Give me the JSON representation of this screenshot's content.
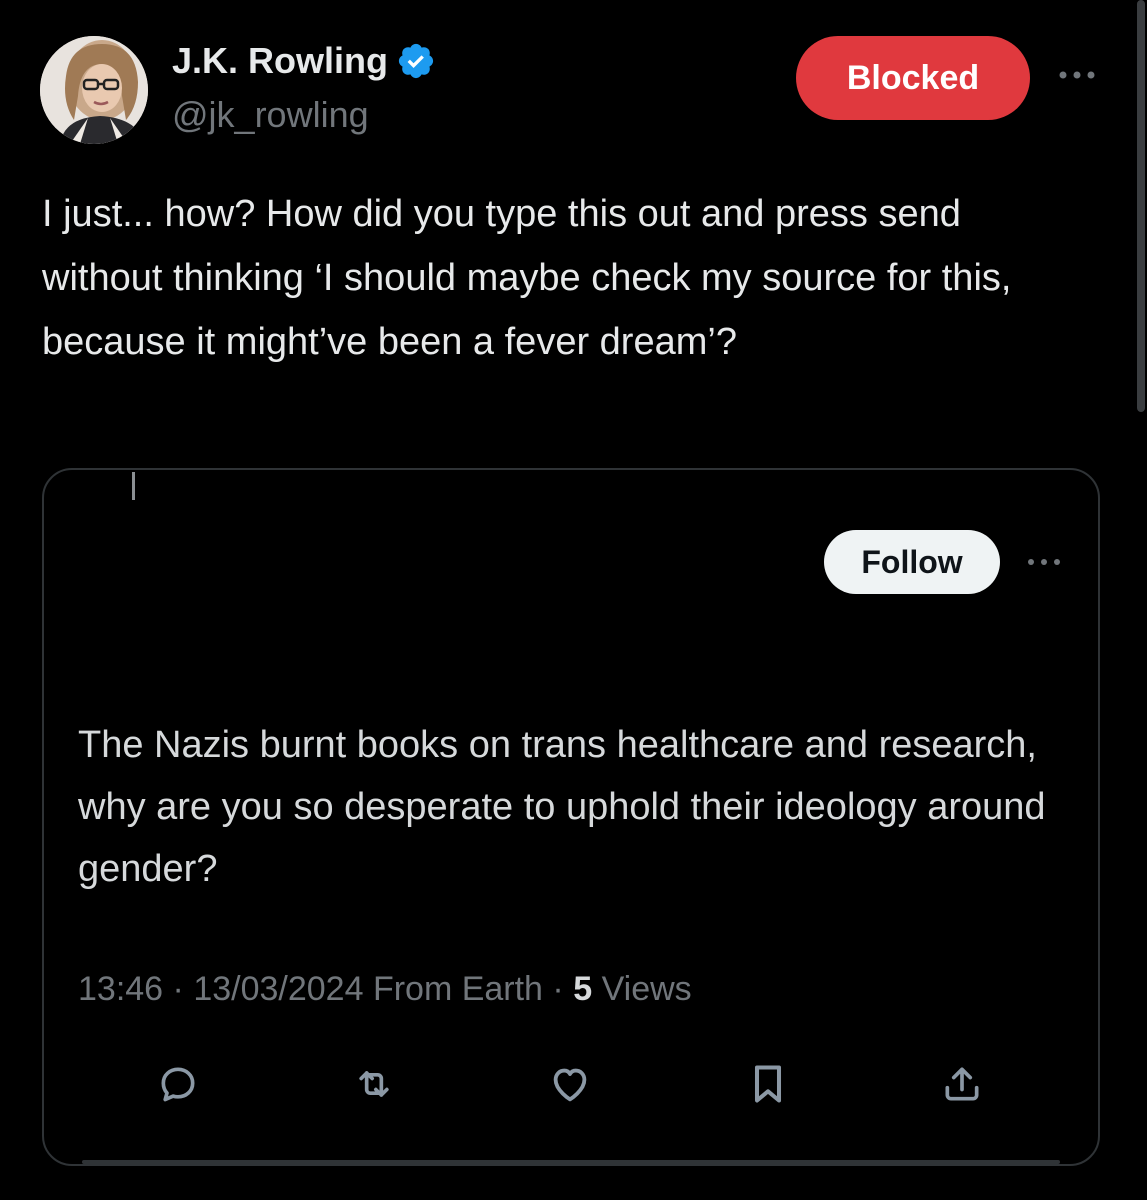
{
  "author": {
    "display_name": "J.K. Rowling",
    "handle": "@jk_rowling",
    "verified_icon": "verified-badge-icon",
    "avatar_icon": "avatar-photo"
  },
  "header": {
    "blocked_label": "Blocked",
    "more_icon": "more-horizontal-icon"
  },
  "tweet": {
    "text": "I just... how? How did you type this out and press send without thinking ‘I should maybe check my source for this, because it might’ve been a fever dream’?"
  },
  "quote": {
    "follow_label": "Follow",
    "text": "The Nazis burnt books on trans healthcare and research, why are you so desperate to uphold their ideology around gender?",
    "time": "13:46",
    "separator": " · ",
    "date": "13/03/2024",
    "source": "From Earth",
    "views_count": "5",
    "views_label": "Views",
    "actions": [
      {
        "name": "reply",
        "icon": "reply-icon"
      },
      {
        "name": "retweet",
        "icon": "retweet-icon"
      },
      {
        "name": "like",
        "icon": "heart-icon"
      },
      {
        "name": "bookmark",
        "icon": "bookmark-icon"
      },
      {
        "name": "share",
        "icon": "share-icon"
      }
    ]
  },
  "colors": {
    "background": "#000000",
    "blocked_red": "#e0393e",
    "verified_blue": "#1d9bf0",
    "muted_text": "#71767b",
    "border": "#2f3336"
  }
}
